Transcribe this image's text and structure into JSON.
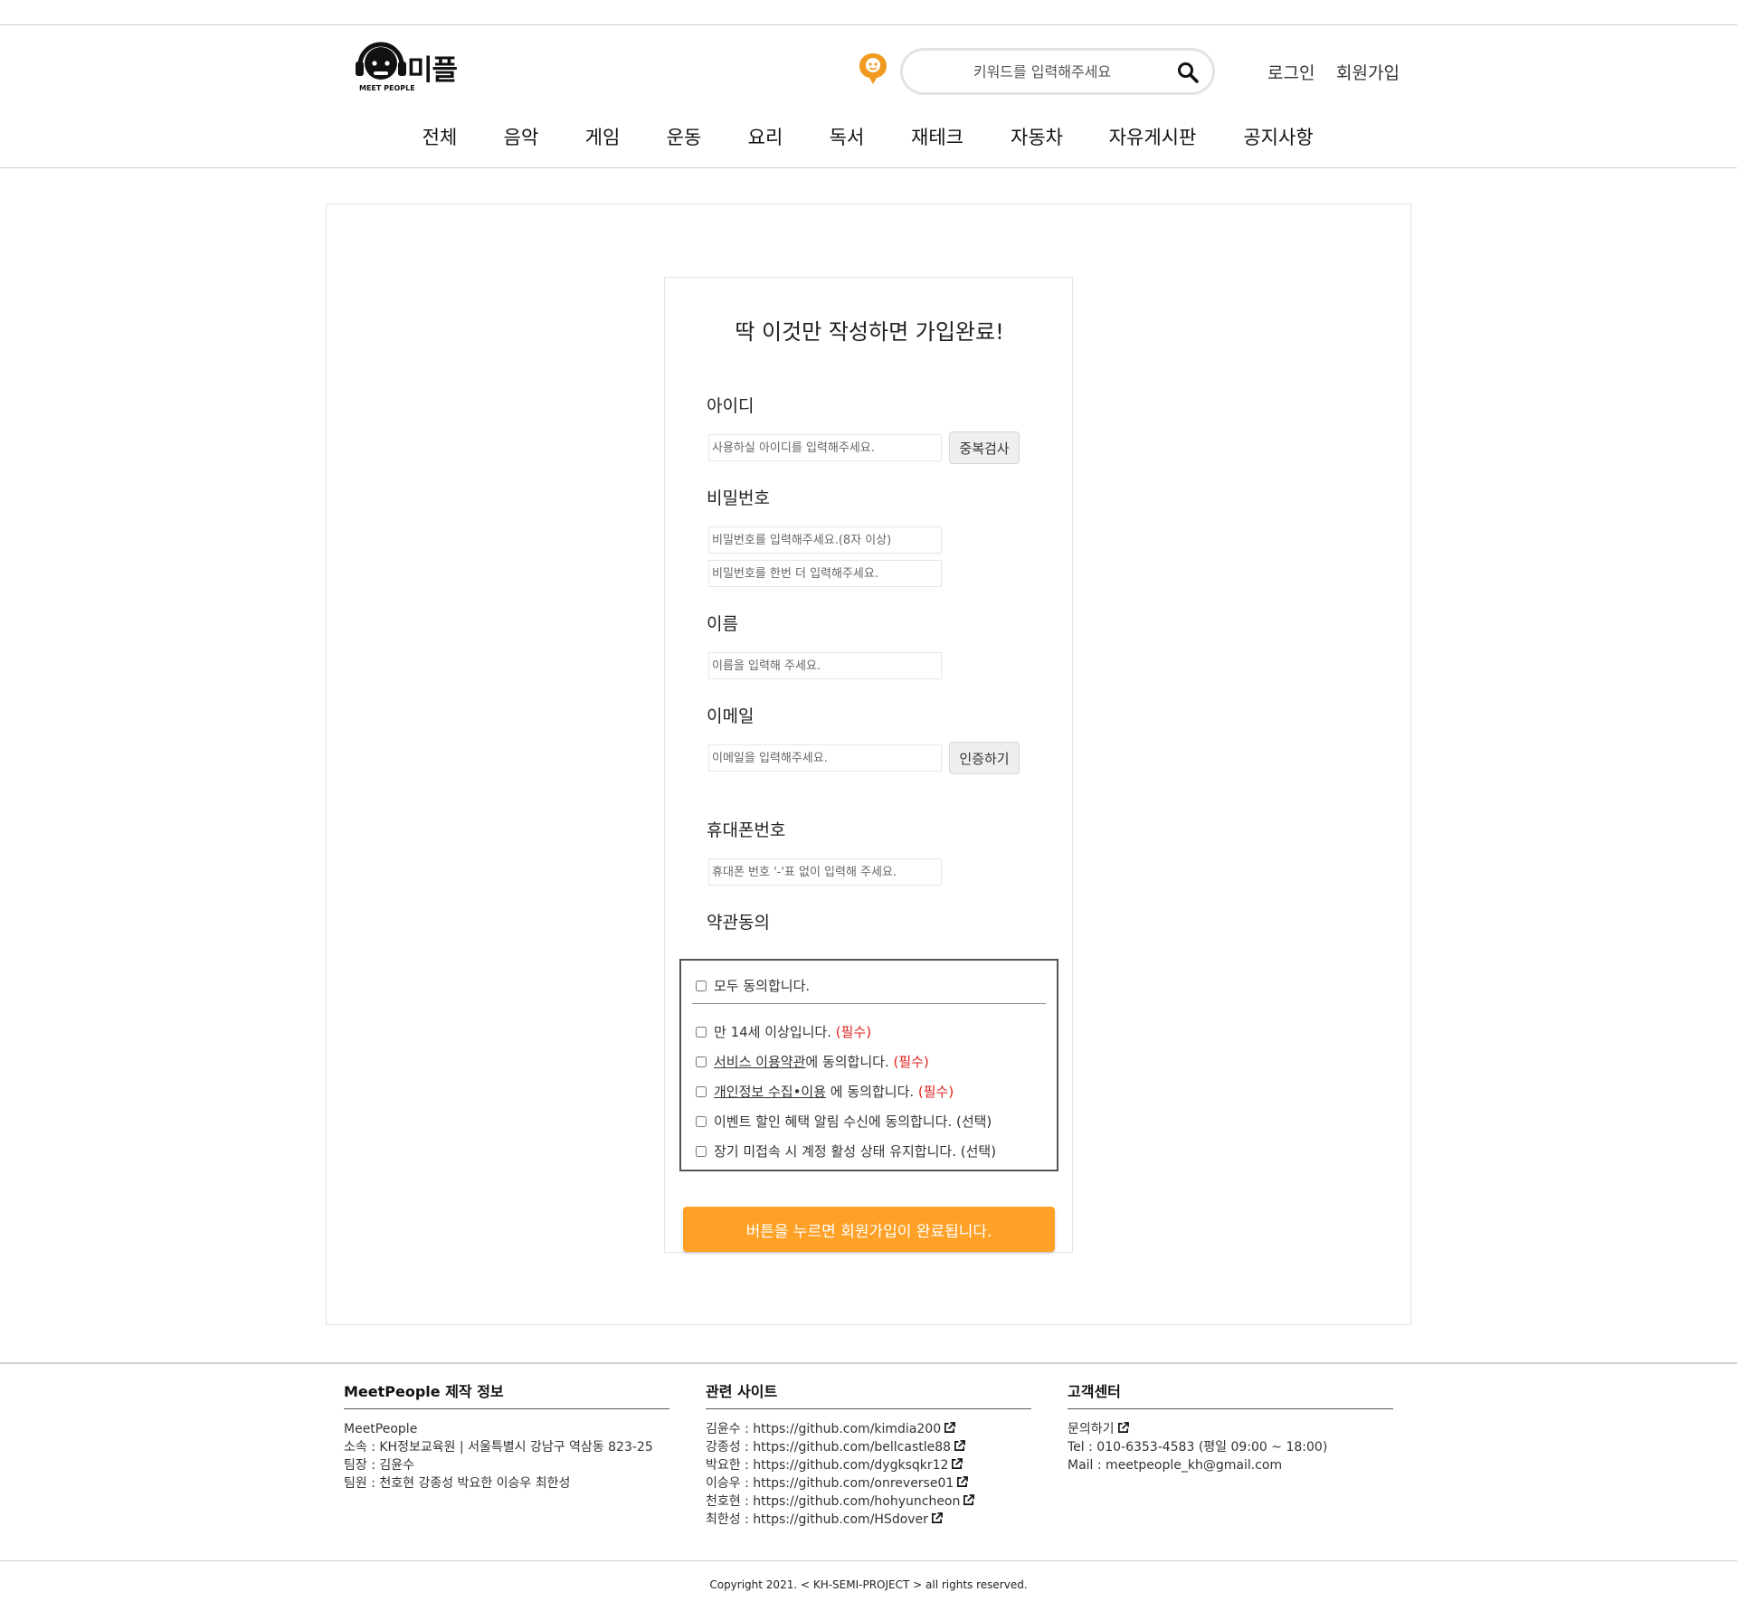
{
  "header": {
    "logo_text": "미플",
    "logo_sub": "MEET PEOPLE",
    "search_placeholder": "키워드를 입력해주세요",
    "login": "로그인",
    "signup": "회원가입"
  },
  "nav": {
    "items": [
      "전체",
      "음악",
      "게임",
      "운동",
      "요리",
      "독서",
      "재테크",
      "자동차",
      "자유게시판",
      "공지사항"
    ]
  },
  "form": {
    "title": "딱 이것만 작성하면 가입완료!",
    "id_label": "아이디",
    "id_placeholder": "사용하실 아이디를 입력해주세요.",
    "dup_check": "중복검사",
    "pw_label": "비밀번호",
    "pw_placeholder": "비밀번호를 입력해주세요.(8자 이상)",
    "pw2_placeholder": "비밀번호를 한번 더 입력해주세요.",
    "name_label": "이름",
    "name_placeholder": "이름을 입력해 주세요.",
    "email_label": "이메일",
    "email_placeholder": "이메일을 입력해주세요.",
    "verify": "인증하기",
    "phone_label": "휴대폰번호",
    "phone_placeholder": "휴대폰 번호 '-'표 없이 입력해 주세요.",
    "terms_label": "약관동의",
    "submit": "버튼을 누르면 회원가입이 완료됩니다."
  },
  "terms": {
    "all": "모두 동의합니다.",
    "t1_text": "만 14세 이상입니다. ",
    "t1_req": "(필수)",
    "t2_link": "서비스 이용약관",
    "t2_text": "에 동의합니다. ",
    "t2_req": "(필수)",
    "t3_link": "개인정보 수집•이용",
    "t3_text": " 에 동의합니다. ",
    "t3_req": "(필수)",
    "t4_text": "이벤트 할인 혜택 알림 수신에 동의합니다. (선택)",
    "t5_text": "장기 미접속 시 계정 활성 상태 유지합니다. (선택)"
  },
  "footer": {
    "col1_title": "MeetPeople 제작 정보",
    "col1_lines": [
      "MeetPeople",
      "소속 : KH정보교육원 | 서울특별시 강남구 역삼동 823-25",
      "팀장 : 김윤수",
      "팀원 : 천호현 강종성 박요한 이승우 최한성"
    ],
    "col2_title": "관련 사이트",
    "col2_lines": [
      "김윤수 : https://github.com/kimdia200",
      "강종성 : https://github.com/bellcastle88",
      "박요한 : https://github.com/dygksqkr12",
      "이승우 : https://github.com/onreverse01",
      "천호현 : https://github.com/hohyuncheon",
      "최한성 : https://github.com/HSdover"
    ],
    "col3_title": "고객센터",
    "col3_link": "문의하기",
    "col3_lines": [
      "Tel : 010-6353-4583 (평일 09:00 ~ 18:00)",
      "Mail : meetpeople_kh@gmail.com"
    ],
    "copyright": "Copyright 2021. < KH-SEMI-PROJECT > all rights reserved."
  },
  "colors": {
    "accent": "#ffa127",
    "required": "#e02020"
  }
}
